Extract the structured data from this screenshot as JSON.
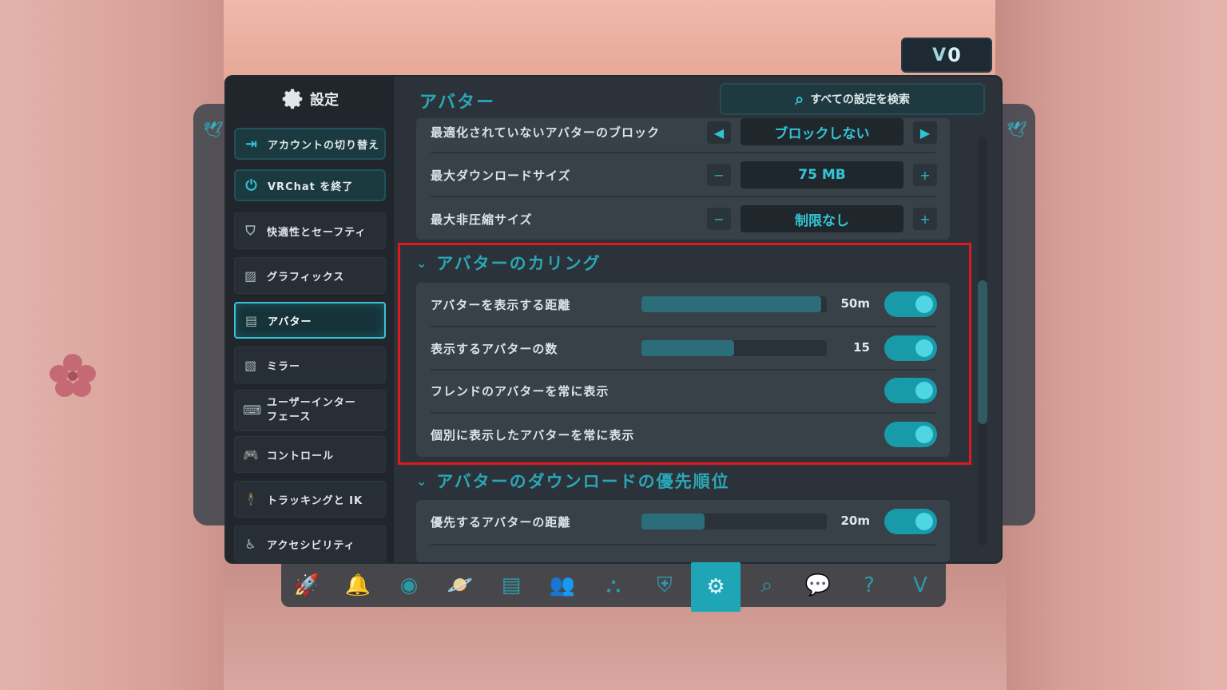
{
  "credits": {
    "value": "0",
    "logo": "V"
  },
  "sidebar": {
    "title": "設定",
    "actions": [
      {
        "label": "アカウントの切り替え",
        "icon": "switch-account-icon"
      },
      {
        "label": "VRChat を終了",
        "icon": "power-icon"
      }
    ],
    "items": [
      {
        "label": "快適性とセーフティ",
        "icon": "shield-icon"
      },
      {
        "label": "グラフィックス",
        "icon": "image-icon"
      },
      {
        "label": "アバター",
        "icon": "avatar-icon",
        "active": true
      },
      {
        "label": "ミラー",
        "icon": "mirror-icon"
      },
      {
        "label": "ユーザーインター",
        "label2": "フェース",
        "icon": "keyboard-icon"
      },
      {
        "label": "コントロール",
        "icon": "gamepad-icon"
      },
      {
        "label": "トラッキングと IK",
        "icon": "tracking-icon"
      },
      {
        "label": "アクセシビリティ",
        "icon": "accessibility-icon"
      }
    ]
  },
  "header": {
    "title": "アバター",
    "search_label": "すべての設定を検索"
  },
  "top_group": {
    "rows": [
      {
        "label": "最適化されていないアバターのブロック",
        "value": "ブロックしない"
      },
      {
        "label": "最大ダウンロードサイズ",
        "value": "75 MB",
        "minus": "−",
        "plus": "+"
      },
      {
        "label": "最大非圧縮サイズ",
        "value": "制限なし",
        "minus": "−",
        "plus": "+"
      }
    ]
  },
  "culling": {
    "title": "アバターのカリング",
    "rows": [
      {
        "label": "アバターを表示する距離",
        "slider_value": "50m",
        "slider_fraction": 0.97,
        "toggle": true
      },
      {
        "label": "表示するアバターの数",
        "slider_value": "15",
        "slider_fraction": 0.5,
        "toggle": true
      },
      {
        "label": "フレンドのアバターを常に表示",
        "toggle": true
      },
      {
        "label": "個別に表示したアバターを常に表示",
        "toggle": true
      }
    ]
  },
  "priority": {
    "title": "アバターのダウンロードの優先順位",
    "rows": [
      {
        "label": "優先するアバターの距離",
        "slider_value": "20m",
        "slider_fraction": 0.34,
        "toggle": true
      }
    ]
  },
  "dock": [
    {
      "icon": "rocket-icon",
      "glyph": "🚀"
    },
    {
      "icon": "bell-icon",
      "glyph": "🔔"
    },
    {
      "icon": "profile-icon",
      "glyph": "◉"
    },
    {
      "icon": "planet-icon",
      "glyph": "🪐"
    },
    {
      "icon": "avatar-book-icon",
      "glyph": "▤"
    },
    {
      "icon": "group-icon",
      "glyph": "👥"
    },
    {
      "icon": "network-icon",
      "glyph": "⛬"
    },
    {
      "icon": "shield-icon",
      "glyph": "⛨"
    },
    {
      "icon": "settings-gear-icon",
      "glyph": "⚙",
      "active": true
    },
    {
      "icon": "search-icon",
      "glyph": "⌕"
    },
    {
      "icon": "chat-add-icon",
      "glyph": "💬"
    },
    {
      "icon": "help-icon",
      "glyph": "?"
    },
    {
      "icon": "vrchat-logo-icon",
      "glyph": "V"
    }
  ],
  "colors": {
    "accent": "#2fc3d3",
    "highlight": "#e0191f",
    "panel": "#2b3239"
  }
}
